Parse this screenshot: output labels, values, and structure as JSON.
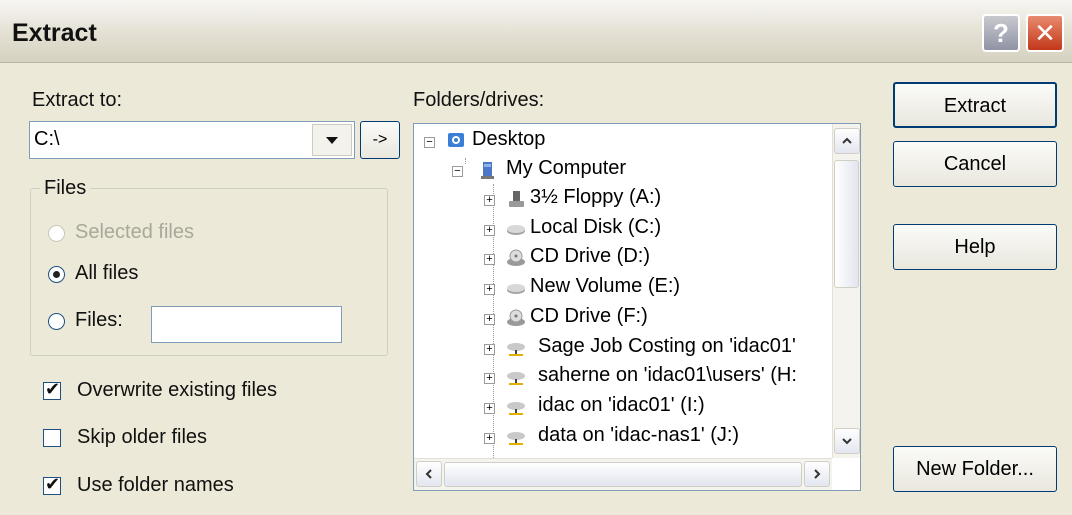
{
  "window": {
    "title": "Extract",
    "help_glyph": "?",
    "close_glyph": "✕"
  },
  "extract_to": {
    "label": "Extract to:",
    "value": "C:\\",
    "arrow_button": "->"
  },
  "files_group": {
    "title": "Files",
    "options": [
      {
        "label": "Selected files",
        "selected": false,
        "enabled": false
      },
      {
        "label": "All files",
        "selected": true,
        "enabled": true
      },
      {
        "label": "Files:",
        "selected": false,
        "enabled": true
      }
    ],
    "files_value": ""
  },
  "checkboxes": [
    {
      "label": "Overwrite existing files",
      "checked": true
    },
    {
      "label": "Skip older files",
      "checked": false
    },
    {
      "label": "Use folder names",
      "checked": true
    }
  ],
  "folders": {
    "label": "Folders/drives:",
    "tree": [
      {
        "label": "Desktop",
        "icon": "desktop-icon"
      },
      {
        "label": "My Computer",
        "icon": "computer-icon"
      },
      {
        "label": "3½ Floppy (A:)",
        "icon": "floppy-icon"
      },
      {
        "label": "Local Disk (C:)",
        "icon": "harddisk-icon"
      },
      {
        "label": "CD Drive (D:)",
        "icon": "cd-drive-icon"
      },
      {
        "label": "New Volume (E:)",
        "icon": "harddisk-icon"
      },
      {
        "label": "CD Drive (F:)",
        "icon": "cd-drive-icon"
      },
      {
        "label": "Sage Job Costing on 'idac01'",
        "icon": "network-drive-icon"
      },
      {
        "label": "saherne on 'idac01\\users' (H:",
        "icon": "network-drive-icon"
      },
      {
        "label": "idac on 'idac01' (I:)",
        "icon": "network-drive-icon"
      },
      {
        "label": "data on 'idac-nas1' (J:)",
        "icon": "network-drive-icon"
      }
    ]
  },
  "buttons": {
    "extract": "Extract",
    "cancel": "Cancel",
    "help": "Help",
    "new_folder": "New Folder..."
  },
  "colors": {
    "dialog_bg": "#ece9d8",
    "close_red": "#c3371a",
    "border_blue": "#003c74"
  }
}
